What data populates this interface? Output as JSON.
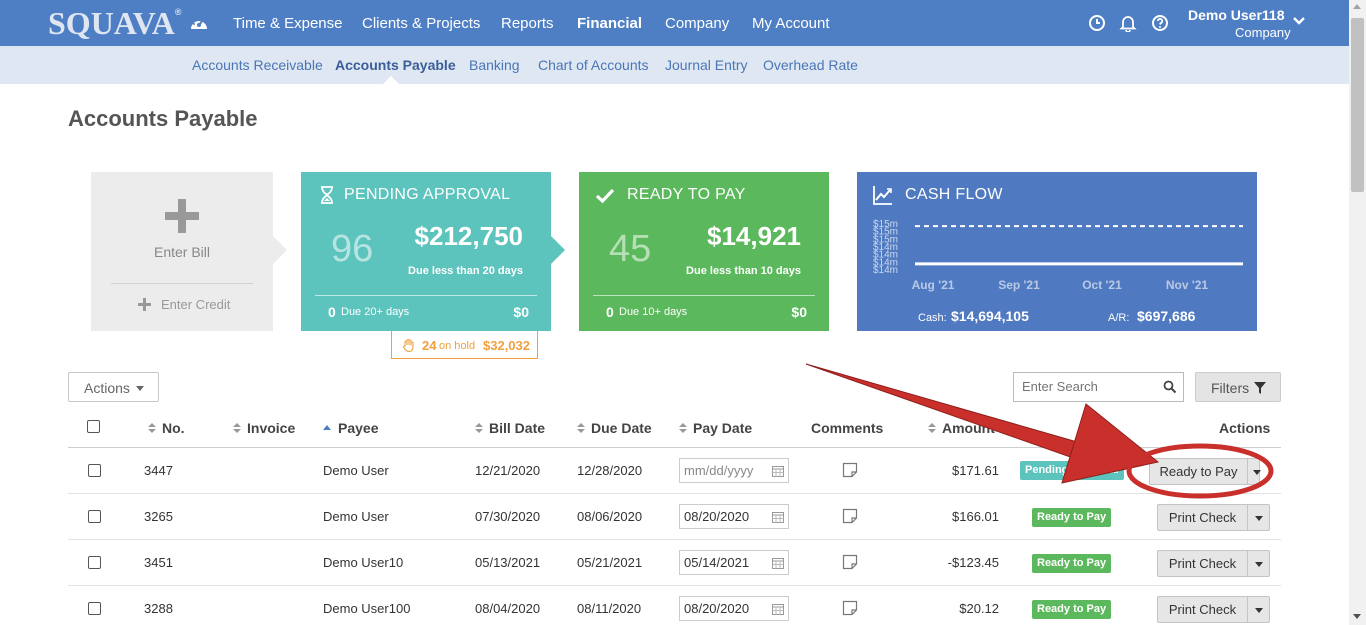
{
  "brand": {
    "logo_text": "SQUAVA",
    "logo_mark": "®"
  },
  "colors": {
    "nav_bar": "#4e7fc4",
    "subnav_bar": "#dfe7f3",
    "pending": "#5cc3bd",
    "ready": "#5cb85c",
    "cash": "#4f79c1",
    "on_hold": "#f0a040",
    "annotation_arrow": "#c9302c"
  },
  "nav": {
    "dashboard_icon": "speedometer-icon",
    "items": [
      "Time & Expense",
      "Clients & Projects",
      "Reports",
      "Financial",
      "Company",
      "My Account"
    ],
    "active": "Financial",
    "tool_icons": [
      "clock-icon",
      "bell-icon",
      "help-icon"
    ],
    "user_name": "Demo User118",
    "user_company": "Company"
  },
  "subnav": {
    "items": [
      "Accounts Receivable",
      "Accounts Payable",
      "Banking",
      "Chart of Accounts",
      "Journal Entry",
      "Overhead Rate"
    ],
    "active": "Accounts Payable"
  },
  "page": {
    "title": "Accounts Payable"
  },
  "enter_bill": {
    "label": "Enter Bill",
    "credit_label": "Enter Credit"
  },
  "pending": {
    "title": "PENDING APPROVAL",
    "icon": "hourglass-icon",
    "count": "96",
    "amount": "$212,750",
    "due_label": "Due less than 20 days",
    "foot_count": "0",
    "foot_label": "Due 20+ days",
    "foot_amount": "$0"
  },
  "on_hold": {
    "icon": "hand-icon",
    "count": "24",
    "label": "on hold",
    "amount": "$32,032"
  },
  "ready": {
    "title": "READY TO PAY",
    "icon": "check-icon",
    "count": "45",
    "amount": "$14,921",
    "due_label": "Due less than 10 days",
    "foot_count": "0",
    "foot_label": "Due 10+ days",
    "foot_amount": "$0"
  },
  "cash_flow": {
    "title": "CASH FLOW",
    "icon": "line-chart-icon",
    "cash_label": "Cash:",
    "cash_value": "$14,694,105",
    "ar_label": "A/R:",
    "ar_value": "$697,686"
  },
  "chart_data": {
    "type": "line",
    "x": [
      "Aug '21",
      "Sep '21",
      "Oct '21",
      "Nov '21"
    ],
    "y_ticks": [
      "$15m",
      "$15m",
      "$15m",
      "$14m",
      "$14m",
      "$14m",
      "$14m"
    ],
    "series": [
      {
        "style": "dashed",
        "values": [
          15.0,
          15.0,
          15.0,
          15.0
        ]
      },
      {
        "style": "solid",
        "values": [
          14.1,
          14.1,
          14.1,
          14.1
        ]
      }
    ],
    "grid": false
  },
  "toolbar": {
    "actions_label": "Actions",
    "search_placeholder": "Enter Search",
    "filters_label": "Filters"
  },
  "table": {
    "columns": [
      "No.",
      "Invoice",
      "Payee",
      "Bill Date",
      "Due Date",
      "Pay Date",
      "Comments",
      "Amount",
      "Actions"
    ],
    "date_placeholder": "mm/dd/yyyy",
    "rows": [
      {
        "no": "3447",
        "invoice": "",
        "payee": "Demo User",
        "bill_date": "12/21/2020",
        "due_date": "12/28/2020",
        "pay_date": "",
        "amount": "$171.61",
        "status": "Pending Approval",
        "action": "Ready to Pay"
      },
      {
        "no": "3265",
        "invoice": "",
        "payee": "Demo User",
        "bill_date": "07/30/2020",
        "due_date": "08/06/2020",
        "pay_date": "08/20/2020",
        "amount": "$166.01",
        "status": "Ready to Pay",
        "action": "Print Check"
      },
      {
        "no": "3451",
        "invoice": "",
        "payee": "Demo User10",
        "bill_date": "05/13/2021",
        "due_date": "05/21/2021",
        "pay_date": "05/14/2021",
        "amount": "-$123.45",
        "status": "Ready to Pay",
        "action": "Print Check"
      },
      {
        "no": "3288",
        "invoice": "",
        "payee": "Demo User100",
        "bill_date": "08/04/2020",
        "due_date": "08/11/2020",
        "pay_date": "08/20/2020",
        "amount": "$20.12",
        "status": "Ready to Pay",
        "action": "Print Check"
      }
    ]
  }
}
